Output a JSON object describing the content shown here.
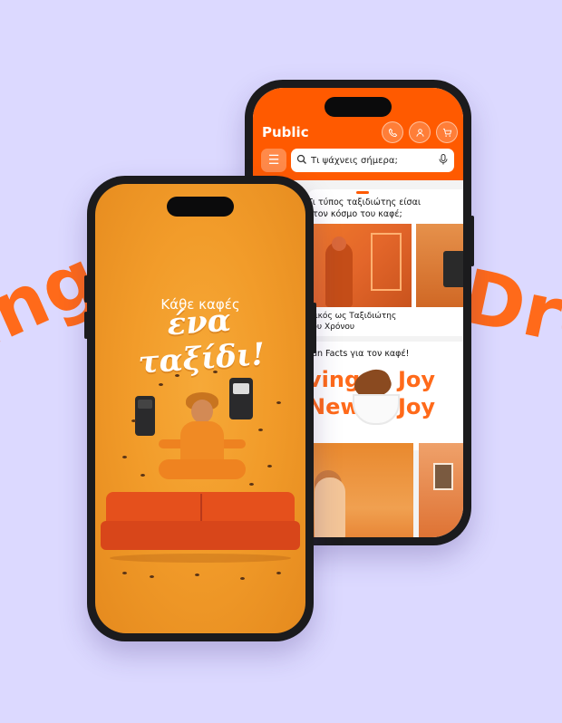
{
  "background": {
    "word_left": "ing",
    "word_right": "Dre",
    "colors": {
      "page_bg": "#dcd9ff",
      "accent": "#ff6a1a"
    }
  },
  "front_screen": {
    "subtitle": "Κάθε καφές",
    "headline": "ένα ταξίδι!"
  },
  "app": {
    "logo": "Public",
    "brand_color": "#ff5a00",
    "header_icons": [
      "phone-icon",
      "user-icon",
      "cart-icon"
    ],
    "menu_icon": "hamburger-icon",
    "search": {
      "placeholder": "Τι ψάχνεις σήμερα;",
      "icon": "search-icon",
      "voice_icon": "microphone-icon"
    },
    "card1": {
      "title": "Τι τύπος ταξιδιώτης είσαι στον κόσμο του καφέ;",
      "caption": "...ικός ως Ταξιδιώτης του Χρόνου"
    },
    "card2": {
      "title": "Fun Facts για τον καφέ!",
      "banner_words": [
        "ving",
        "Joy",
        "New",
        "Joy"
      ]
    }
  }
}
